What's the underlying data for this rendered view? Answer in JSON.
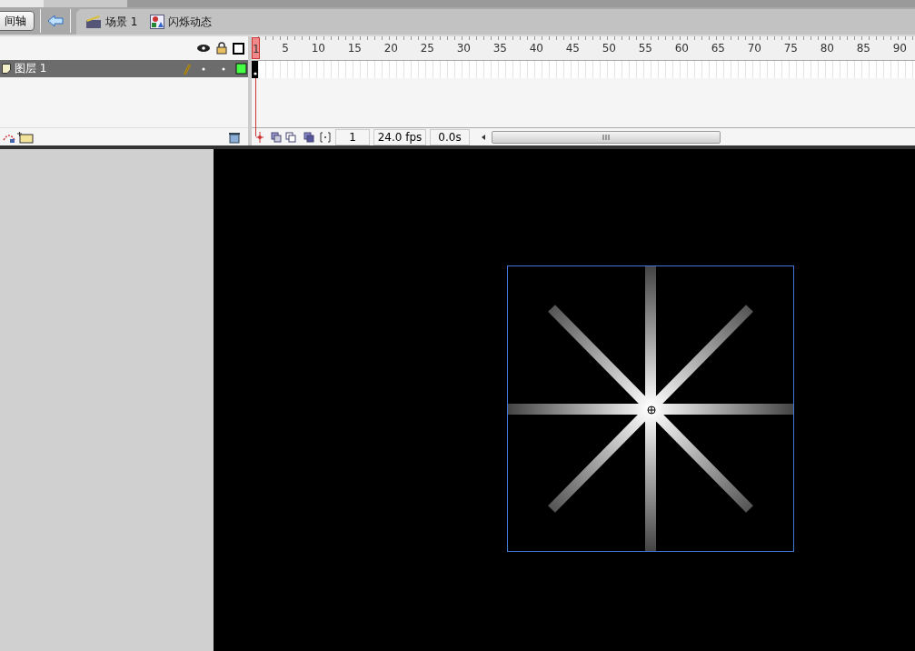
{
  "edit_bar": {
    "timeline_button": "间轴",
    "scenes": [
      {
        "label": "场景 1",
        "kind": "scene"
      },
      {
        "label": "闪烁动态",
        "kind": "symbol"
      }
    ]
  },
  "timeline": {
    "ruler": [
      {
        "label": "1",
        "selected": true
      },
      {
        "label": "5",
        "selected": false
      },
      {
        "label": "10",
        "selected": false
      },
      {
        "label": "15",
        "selected": false
      },
      {
        "label": "20",
        "selected": false
      },
      {
        "label": "25",
        "selected": false
      },
      {
        "label": "30",
        "selected": false
      },
      {
        "label": "35",
        "selected": false
      },
      {
        "label": "40",
        "selected": false
      },
      {
        "label": "45",
        "selected": false
      },
      {
        "label": "50",
        "selected": false
      },
      {
        "label": "55",
        "selected": false
      },
      {
        "label": "60",
        "selected": false
      },
      {
        "label": "65",
        "selected": false
      },
      {
        "label": "70",
        "selected": false
      },
      {
        "label": "75",
        "selected": false
      },
      {
        "label": "80",
        "selected": false
      },
      {
        "label": "85",
        "selected": false
      },
      {
        "label": "90",
        "selected": false
      }
    ],
    "layers": [
      {
        "name": "图层 1",
        "selected": true
      }
    ],
    "current_frame": "1",
    "frame_rate": "24.0 fps",
    "elapsed_time": "0.0s"
  }
}
